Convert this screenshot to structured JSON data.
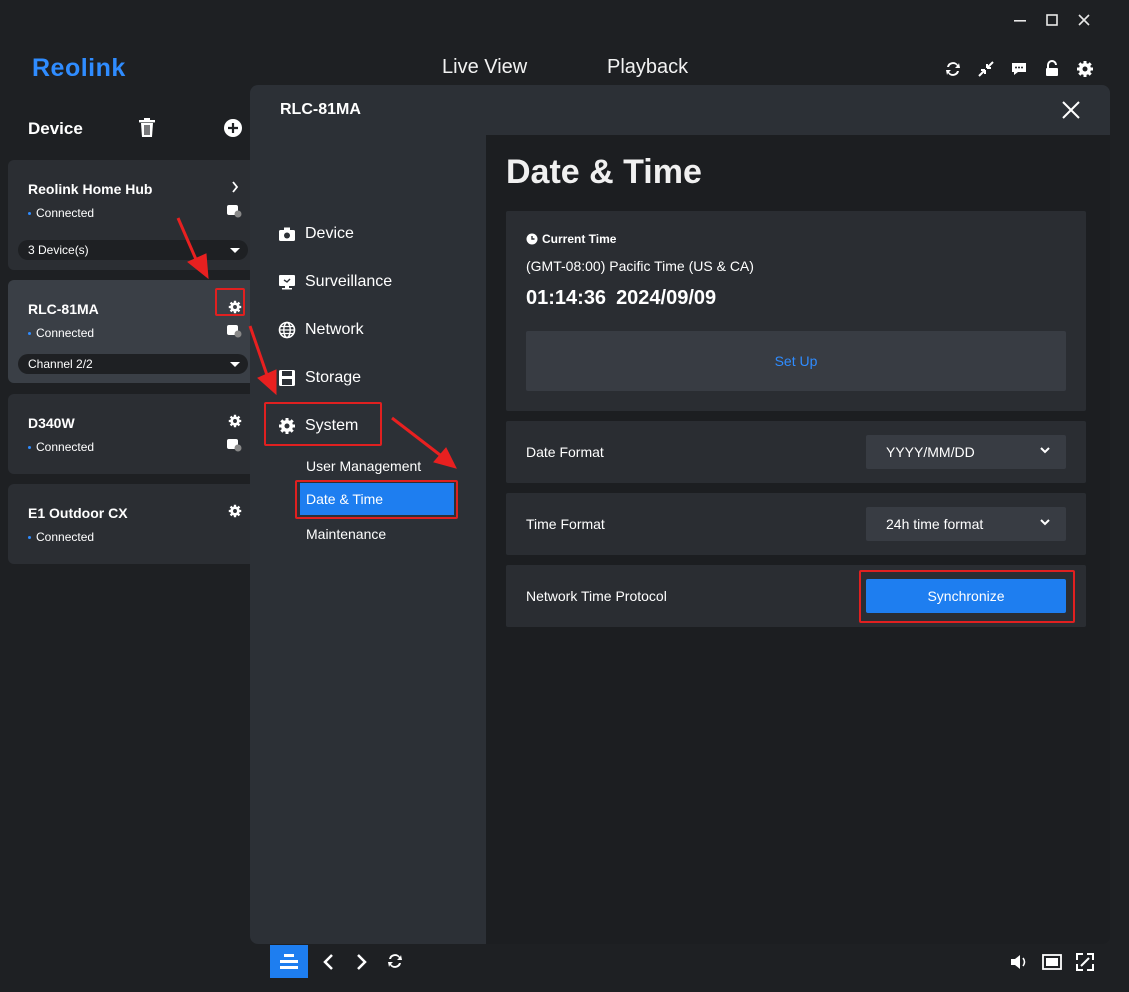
{
  "app": {
    "logo": "Reolink",
    "nav_live_view": "Live View",
    "nav_playback": "Playback",
    "window_controls": [
      "minimize-icon",
      "maximize-icon",
      "close-icon"
    ],
    "toolbar_icons": [
      "sync-icon",
      "collapse-icon",
      "message-icon",
      "unlock-icon",
      "gear-icon"
    ]
  },
  "sidebar": {
    "title": "Device",
    "devices": [
      {
        "name": "Reolink Home Hub",
        "status": "Connected",
        "dropdown": "3 Device(s)"
      },
      {
        "name": "RLC-81MA",
        "status": "Connected",
        "dropdown": "Channel 2/2"
      },
      {
        "name": "D340W",
        "status": "Connected"
      },
      {
        "name": "E1 Outdoor CX",
        "status": "Connected"
      }
    ]
  },
  "panel": {
    "title": "RLC-81MA",
    "menu": [
      "Device",
      "Surveillance",
      "Network",
      "Storage",
      "System"
    ],
    "submenu": [
      "User Management",
      "Date & Time",
      "Maintenance"
    ],
    "page_title": "Date & Time",
    "current_time": {
      "label": "Current Time",
      "timezone": "(GMT-08:00) Pacific Time (US & CA)",
      "time": "01:14:36",
      "date": "2024/09/09",
      "setup_button": "Set Up"
    },
    "date_format": {
      "label": "Date Format",
      "value": "YYYY/MM/DD"
    },
    "time_format": {
      "label": "Time Format",
      "value": "24h time format"
    },
    "ntp": {
      "label": "Network Time Protocol",
      "button": "Synchronize"
    }
  },
  "colors": {
    "accent": "#1e7ef0",
    "highlight": "#e02020",
    "link": "#2f8cff"
  }
}
